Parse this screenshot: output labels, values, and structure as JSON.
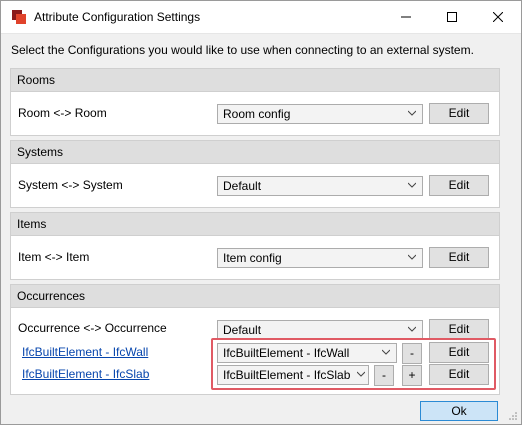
{
  "window": {
    "title": "Attribute Configuration Settings",
    "instruction": "Select the Configurations you would like to use when connecting to an external system."
  },
  "groups": {
    "rooms": {
      "header": "Rooms",
      "row_label": "Room <->  Room",
      "combo_value": "Room config",
      "edit_label": "Edit"
    },
    "systems": {
      "header": "Systems",
      "row_label": "System <->  System",
      "combo_value": "Default",
      "edit_label": "Edit"
    },
    "items": {
      "header": "Items",
      "row_label": "Item <->  Item",
      "combo_value": "Item config",
      "edit_label": "Edit"
    },
    "occurrences": {
      "header": "Occurrences",
      "row_label": "Occurrence <->  Occurrence",
      "combo_value": "Default",
      "edit_label": "Edit",
      "mappings": [
        {
          "link": "IfcBuiltElement - IfcWall",
          "combo_value": "IfcBuiltElement - IfcWall",
          "minus": "-",
          "edit_label": "Edit"
        },
        {
          "link": "IfcBuiltElement - IfcSlab",
          "combo_value": "IfcBuiltElement - IfcSlab",
          "minus": "-",
          "plus": "+",
          "edit_label": "Edit"
        }
      ]
    }
  },
  "footer": {
    "ok_label": "Ok"
  },
  "colors": {
    "highlight": "#e05a64",
    "link": "#0645ad",
    "ok_border": "#2a8ad4"
  }
}
